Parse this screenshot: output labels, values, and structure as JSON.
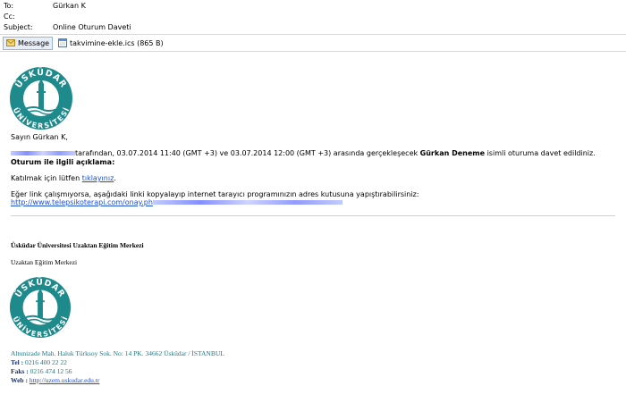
{
  "header": {
    "to_label": "To:",
    "to_value": "Gürkan K",
    "cc_label": "Cc:",
    "cc_value": "",
    "subject_label": "Subject:",
    "subject_value": "Online Oturum Daveti"
  },
  "tabs": [
    {
      "label": "Message",
      "icon": "envelope-icon",
      "selected": true
    },
    {
      "label": "takvimine-ekle.ics (865 B)",
      "icon": "calendar-file-icon",
      "selected": false
    }
  ],
  "logo": {
    "top_text": "ÜSKÜDAR",
    "bottom_text": "ÜNİVERSİTESİ",
    "color": "#1e8a8c"
  },
  "body": {
    "greeting": "Sayın Gürkan K,",
    "invite_pre": "tarafından, 03.07.2014 11:40 (GMT +3) ve 03.07.2014 12:00 (GMT +3) arasında gerçekleşecek ",
    "session_name": "Gürkan Deneme",
    "invite_post": " isimli oturuma davet edildiniz.",
    "description_label": "Oturum ile ilgili açıklama:",
    "join_pre": "Katılmak için lütfen ",
    "join_link": "tıklayınız",
    "join_post": ".",
    "fallback_text": "Eğer link çalışmıyorsa, aşağıdaki linki kopyalayıp internet tarayıcı programınızın adres kutusuna yapıştırabilirsiniz:",
    "fallback_link": "http://www.telepsikoterapi.com/onay.ph"
  },
  "signature": {
    "org_bold": "Üsküdar Üniversitesi Uzaktan Eğitim Merkezi",
    "dept": "Uzaktan Eğitim Merkezi",
    "address": "Altunizade Mah. Haluk Türksoy Sok. No: 14 PK. 34662 Üsküdar / İSTANBUL",
    "tel_label": "Tel :",
    "tel_value": " 0216 400 22 22",
    "fax_label": "Faks :",
    "fax_value": " 0216 474 12 56",
    "web_label": "Web :",
    "web_value": "http://uzem.uskudar.edu.tr"
  },
  "colors": {
    "link": "#1a4fd6",
    "teal": "#1e7a86",
    "navy": "#13327a"
  }
}
